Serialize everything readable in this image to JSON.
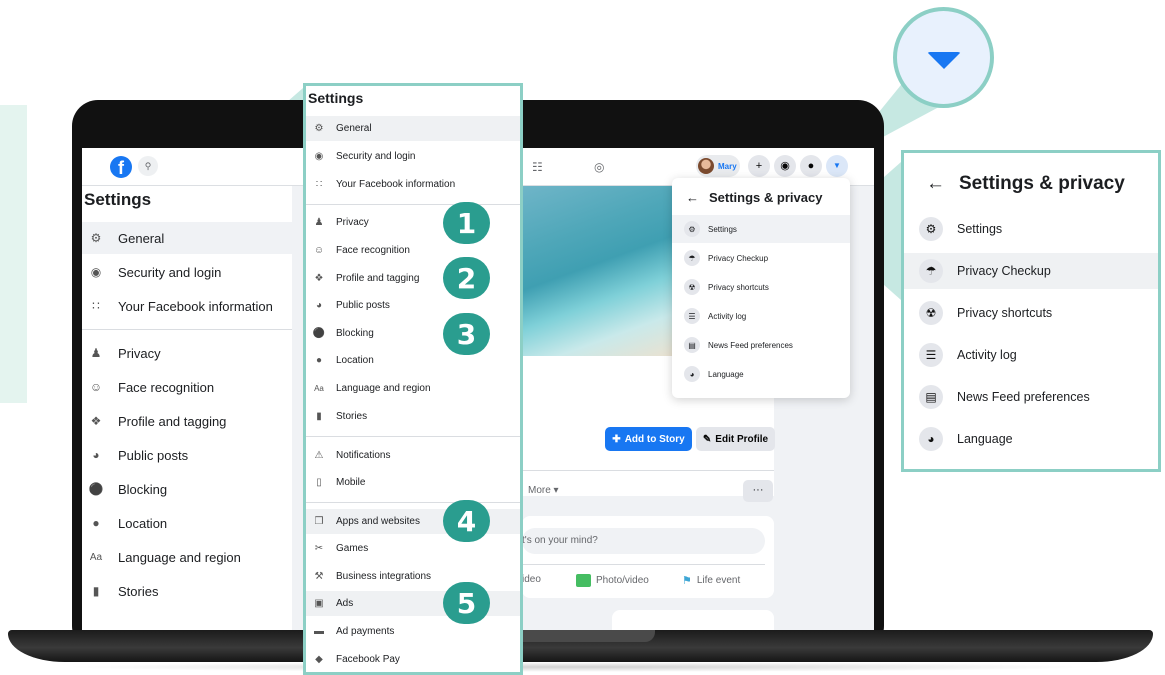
{
  "topbar": {
    "user_name": "Mary",
    "search_icon": "search-icon",
    "plus_icon": "plus-icon",
    "messenger_icon": "messenger-icon",
    "bell_icon": "bell-icon",
    "caret_icon": "caret-down-icon"
  },
  "settings_title": "Settings",
  "screen_settings_items": [
    {
      "label": "General",
      "icon": "gear-icon"
    },
    {
      "label": "Security and login",
      "icon": "shield-icon"
    },
    {
      "label": "Your Facebook information",
      "icon": "info-grid-icon"
    },
    {
      "label": "Privacy",
      "icon": "privacy-icon"
    },
    {
      "label": "Face recognition",
      "icon": "face-icon"
    },
    {
      "label": "Profile and tagging",
      "icon": "tag-icon"
    },
    {
      "label": "Public posts",
      "icon": "globe-icon"
    },
    {
      "label": "Blocking",
      "icon": "block-icon"
    },
    {
      "label": "Location",
      "icon": "location-icon"
    },
    {
      "label": "Language and region",
      "icon": "language-icon"
    },
    {
      "label": "Stories",
      "icon": "stories-icon"
    }
  ],
  "zoom_panel": {
    "title": "Settings",
    "items": [
      {
        "label": "General"
      },
      {
        "label": "Security and login"
      },
      {
        "label": "Your Facebook information"
      },
      {
        "label": "Privacy"
      },
      {
        "label": "Face recognition"
      },
      {
        "label": "Profile and tagging"
      },
      {
        "label": "Public posts"
      },
      {
        "label": "Blocking"
      },
      {
        "label": "Location"
      },
      {
        "label": "Language and region"
      },
      {
        "label": "Stories"
      },
      {
        "label": "Notifications"
      },
      {
        "label": "Mobile"
      },
      {
        "label": "Apps and websites"
      },
      {
        "label": "Games"
      },
      {
        "label": "Business integrations"
      },
      {
        "label": "Ads"
      },
      {
        "label": "Ad payments"
      },
      {
        "label": "Facebook Pay"
      }
    ],
    "badges": [
      "1",
      "2",
      "3",
      "4",
      "5"
    ]
  },
  "profile": {
    "add_story": "Add to Story",
    "edit_profile": "Edit Profile",
    "more_tab": "More ▾",
    "dots": "···",
    "mind_placeholder": "t's on your mind?",
    "actions": [
      "ideo",
      "Photo/video",
      "Life event"
    ]
  },
  "dropdown": {
    "title": "Settings & privacy",
    "items": [
      {
        "label": "Settings",
        "icon": "gear-icon"
      },
      {
        "label": "Privacy Checkup",
        "icon": "lock-heart-icon"
      },
      {
        "label": "Privacy shortcuts",
        "icon": "lock-icon"
      },
      {
        "label": "Activity log",
        "icon": "list-icon"
      },
      {
        "label": "News Feed preferences",
        "icon": "feed-icon"
      },
      {
        "label": "Language",
        "icon": "globe-icon"
      }
    ]
  },
  "colors": {
    "facebook_blue": "#1877f2",
    "highlight_teal": "#8ccfc5",
    "badge_teal": "#2a9d8f"
  }
}
